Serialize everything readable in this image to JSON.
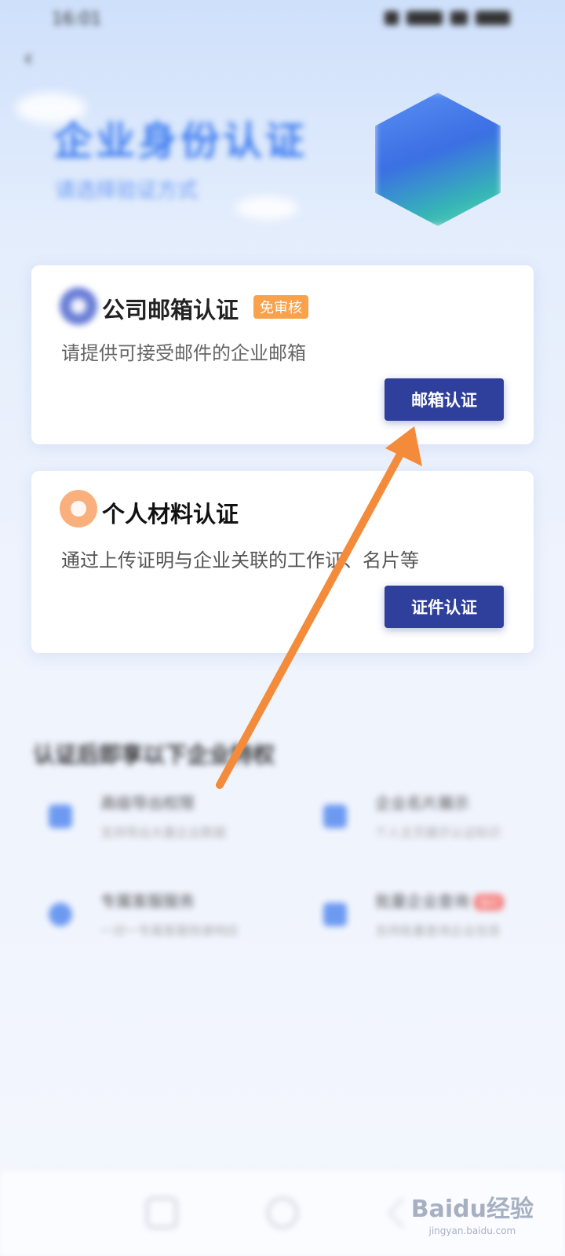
{
  "status_bar": {
    "time": "16:01"
  },
  "header": {
    "title": "企业身份认证",
    "subtitle": "请选择验证方式"
  },
  "cards": {
    "email": {
      "title": "公司邮箱认证",
      "badge": "免审核",
      "description": "请提供可接受邮件的企业邮箱",
      "button_label": "邮箱认证"
    },
    "personal": {
      "title": "个人材料认证",
      "description": "通过上传证明与企业关联的工作证、名片等",
      "button_label": "证件认证"
    }
  },
  "privileges": {
    "title": "认证后即享以下企业特权",
    "items": [
      {
        "name": "高级导出权限",
        "description": "支持导出大量企业数据",
        "hot": ""
      },
      {
        "name": "企业名片展示",
        "description": "个人主页展示认证标识",
        "hot": ""
      },
      {
        "name": "专属客服服务",
        "description": "一对一专属客服快速响应",
        "hot": ""
      },
      {
        "name": "批量企业查询",
        "description": "支持批量查询企业信息",
        "hot": "限时"
      }
    ]
  },
  "watermark": {
    "logo": "Baidu经验",
    "sub": "jingyan.baidu.com"
  },
  "colors": {
    "primary_button": "#2f3f9c",
    "badge": "#f9a24b",
    "arrow": "#f38b3a",
    "hero_title": "#3d7cf0"
  }
}
